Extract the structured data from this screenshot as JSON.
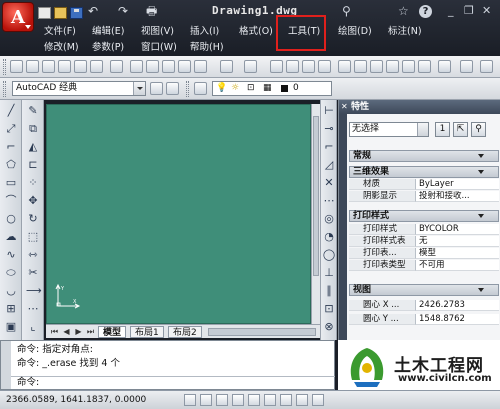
{
  "window": {
    "title": "Drawing1.dwg",
    "app_button_glyph": "A"
  },
  "quick_access": {
    "undo_glyph": "↶",
    "redo_glyph": "↷",
    "print_glyph": "🖶"
  },
  "menu": {
    "row1": [
      "文件(F)",
      "编辑(E)",
      "视图(V)",
      "插入(I)",
      "格式(O)",
      "工具(T)",
      "绘图(D)",
      "标注(N)"
    ],
    "row2": [
      "修改(M)",
      "参数(P)",
      "窗口(W)",
      "帮助(H)"
    ],
    "highlighted": "工具(T)"
  },
  "infocenter": {
    "binoculars_glyph": "⚲",
    "help_glyph": "?",
    "star_glyph": "☆",
    "minimize": "_",
    "restore": "❐",
    "close": "✕"
  },
  "toolbar2": {
    "workspace": "AutoCAD 经典",
    "layer_value": "0"
  },
  "tabs": {
    "items": [
      "模型",
      "布局1",
      "布局2"
    ],
    "active": "模型"
  },
  "properties": {
    "title": "特性",
    "close_glyph": "✕",
    "selection": "无选择",
    "sections": {
      "general": "常规",
      "3d_effects": "三维效果",
      "plot_style": "打印样式",
      "view": "视图"
    },
    "rows_3d": [
      {
        "key": "材质",
        "value": "ByLayer"
      },
      {
        "key": "阴影显示",
        "value": "投射和接收..."
      }
    ],
    "rows_plot": [
      {
        "key": "打印样式",
        "value": "BYCOLOR"
      },
      {
        "key": "打印样式表",
        "value": "无"
      },
      {
        "key": "打印表...",
        "value": "模型"
      },
      {
        "key": "打印表类型",
        "value": "不可用"
      }
    ],
    "rows_view": [
      {
        "key": "圆心 X ...",
        "value": "2426.2783"
      },
      {
        "key": "圆心 Y ...",
        "value": "1548.8762"
      }
    ]
  },
  "command": {
    "line1": "命令: 指定对角点:",
    "line2": "命令: _.erase 找到 4 个",
    "prompt": "命令:"
  },
  "status": {
    "coords": "2366.0589, 1641.1837, 0.0000"
  },
  "watermark": {
    "text": "土木工程网",
    "url": "www.civilcn.com"
  },
  "colors": {
    "canvas": "#3f8e79",
    "highlight_box": "#e0201c",
    "titlebar": "#1b1f27"
  }
}
